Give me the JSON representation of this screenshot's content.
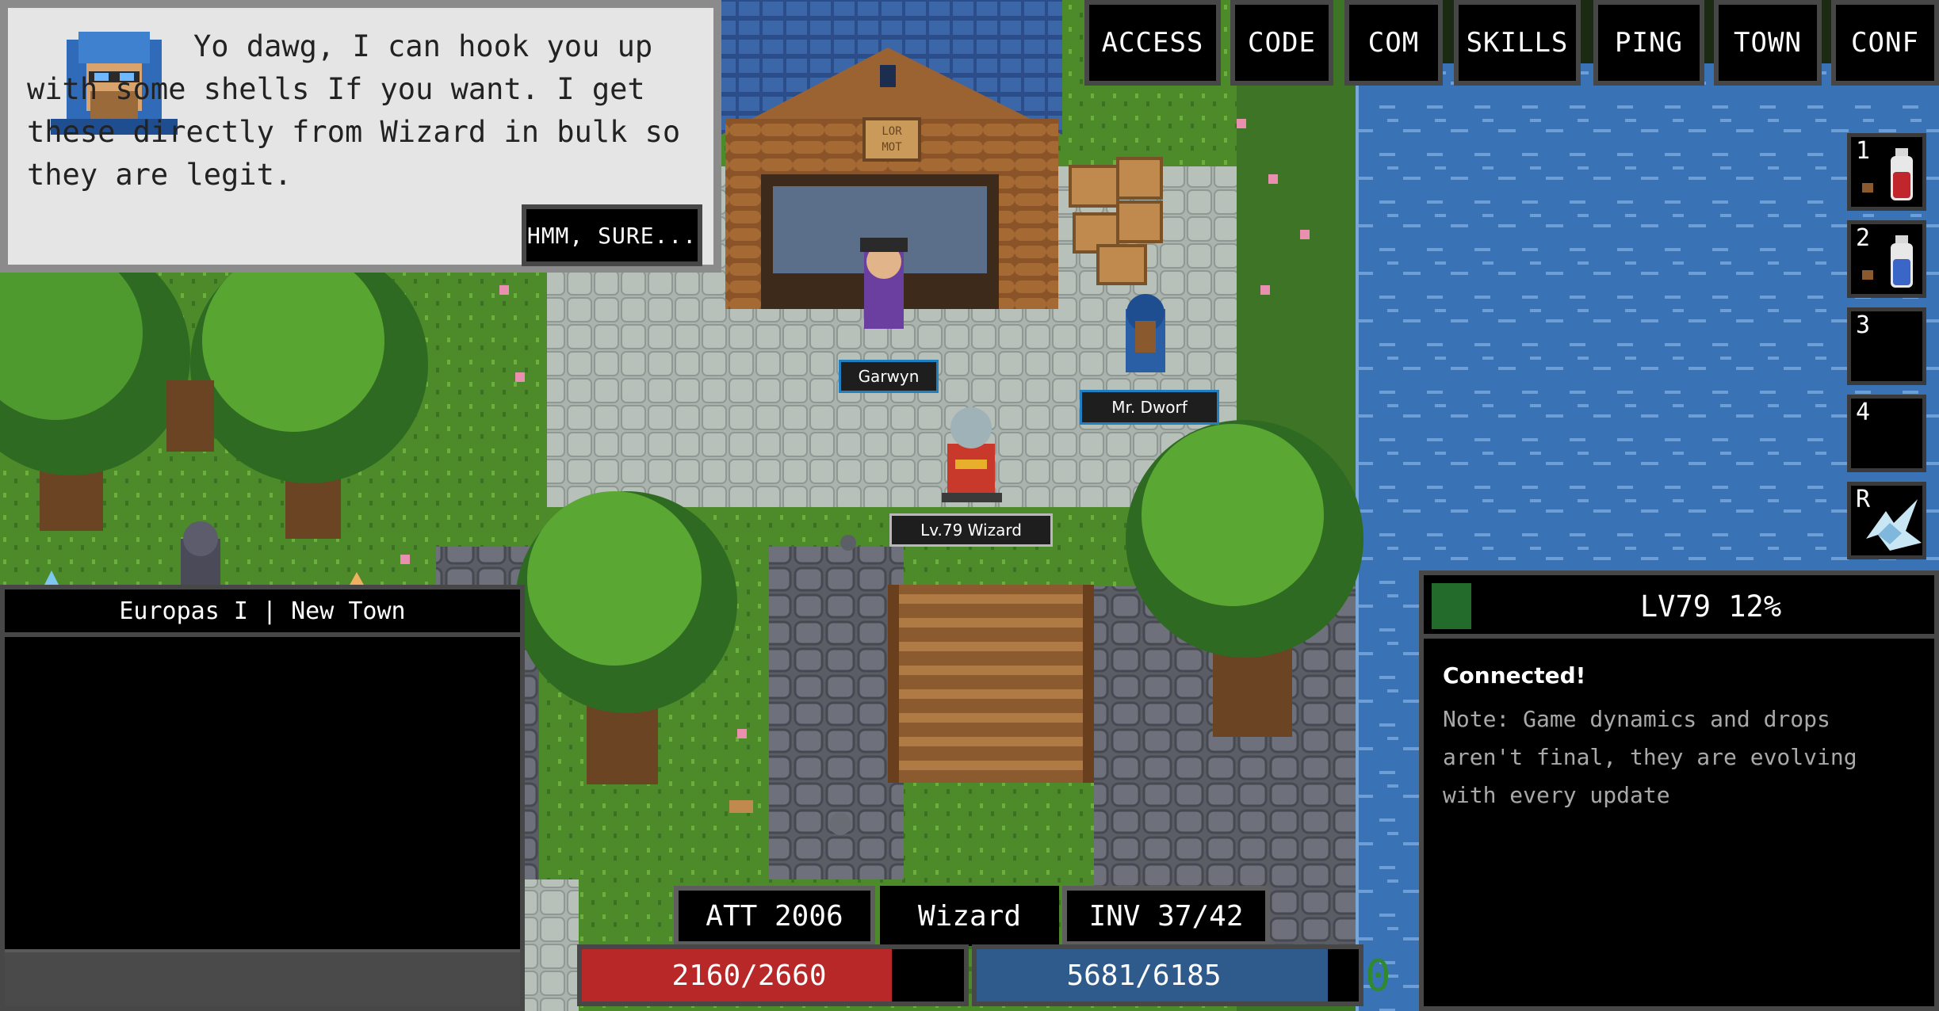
{
  "dialog": {
    "text": "Yo dawg, I can hook you up with some shells If you want. I get these directly from Wizard in bulk so they are legit.",
    "reply_button": "HMM, SURE..."
  },
  "menu": [
    "ACCESS",
    "CODE",
    "COM",
    "SKILLS",
    "PING",
    "TOWN",
    "CONF"
  ],
  "map_labels": {
    "npc1": "Garwyn",
    "npc2": "Mr. Dworf",
    "player": "Lv.79 Wizard",
    "shop_sign": "LOR MOT"
  },
  "chat": {
    "title": "Europas I | New Town"
  },
  "quickslots": [
    {
      "key": "1",
      "icon": "red-potion-icon"
    },
    {
      "key": "2",
      "icon": "blue-potion-icon"
    },
    {
      "key": "3",
      "icon": ""
    },
    {
      "key": "4",
      "icon": ""
    },
    {
      "key": "R",
      "icon": "frost-spell-icon"
    }
  ],
  "level": {
    "text": "LV79 12%",
    "progress": 0.12
  },
  "log": {
    "connected": "Connected!",
    "note": "Note: Game dynamics and drops aren't final, they are evolving with every update"
  },
  "stats": {
    "attack": "ATT 2006",
    "class": "Wizard",
    "inventory": "INV 37/42"
  },
  "hp": {
    "text": "2160/2660",
    "current": 2160,
    "max": 2660,
    "color": "#b82828"
  },
  "mp": {
    "text": "5681/6185",
    "current": 5681,
    "max": 6185,
    "color": "#2e5a8c"
  },
  "gold": "0",
  "colors": {
    "water": "#3a72b6",
    "grass": "#4f8f2a",
    "plaza": "#a9b2aa",
    "accent_tag_border": "#1f7fc0"
  }
}
